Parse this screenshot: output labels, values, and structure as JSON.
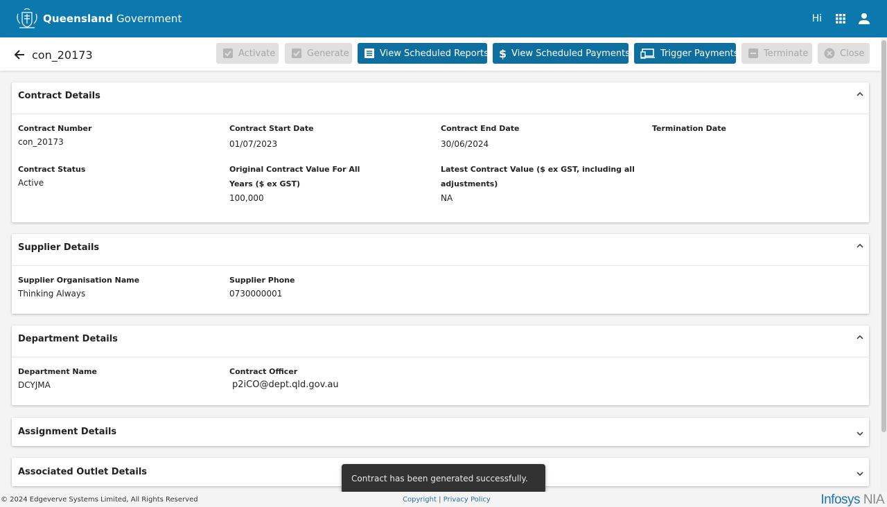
{
  "header": {
    "brand_bold": "Queensland",
    "brand_light": "Government",
    "greeting": "Hi",
    "apps_icon": "grid-apps-icon",
    "user_icon": "account-icon"
  },
  "toolbar": {
    "contract_id": "con_20173",
    "activate": "Activate",
    "generate": "Generate",
    "view_reports": "View Scheduled Reports",
    "view_payments": "View Scheduled Payments",
    "trigger_payments": "Trigger Payments",
    "terminate": "Terminate",
    "close": "Close"
  },
  "contract": {
    "title": "Contract Details",
    "number_label": "Contract Number",
    "number_value": "con_20173",
    "start_label": "Contract Start Date",
    "start_value": "01/07/2023",
    "end_label": "Contract End Date",
    "end_value": "30/06/2024",
    "termination_label": "Termination Date",
    "status_label": "Contract Status",
    "status_value": "Active",
    "orig_value_label_1": "Original Contract Value For All",
    "orig_value_label_2": "Years ($ ex GST)",
    "orig_value_value": "100,000",
    "latest_value_label_1": "Latest Contract Value ($ ex GST, including all",
    "latest_value_label_2": "adjustments)",
    "latest_value_value": "NA"
  },
  "supplier": {
    "title": "Supplier Details",
    "org_label": "Supplier Organisation Name",
    "org_value": "Thinking Always",
    "phone_label": "Supplier Phone",
    "phone_value": "0730000001"
  },
  "department": {
    "title": "Department Details",
    "name_label": "Department Name",
    "name_value": "DCYJMA",
    "officer_label": "Contract Officer",
    "officer_value": "p2iCO@dept.qld.gov.au"
  },
  "assignment": {
    "title": "Assignment Details"
  },
  "outlet": {
    "title": "Associated Outlet Details"
  },
  "toast": {
    "message": "Contract has been generated successfully."
  },
  "footer": {
    "copyright": "© 2024 Edgeverve Systems Limited, All Rights Reserved",
    "copyright_link": "Copyright",
    "separator": "|",
    "privacy_link": "Privacy Policy",
    "logo_main": "Infosys",
    "logo_suffix": "NIA"
  },
  "colors": {
    "header_bg": "#0b79ad",
    "primary_button": "#0e6f9f",
    "disabled_button": "#e0e0e0",
    "toast_bg": "#323232"
  }
}
